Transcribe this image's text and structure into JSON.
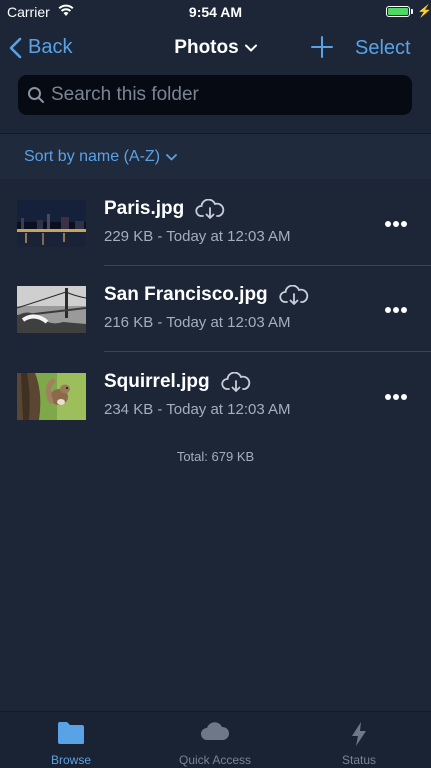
{
  "status_bar": {
    "carrier": "Carrier",
    "time": "9:54 AM",
    "battery_level": 1.0
  },
  "nav": {
    "back_label": "Back",
    "title": "Photos",
    "select_label": "Select"
  },
  "search": {
    "placeholder": "Search this folder",
    "value": ""
  },
  "sort": {
    "label": "Sort by name (A-Z)"
  },
  "files": [
    {
      "name": "Paris.jpg",
      "meta": "229 KB - Today at 12:03 AM",
      "thumbnail": "night-city-skyline"
    },
    {
      "name": "San Francisco.jpg",
      "meta": "216 KB - Today at 12:03 AM",
      "thumbnail": "golden-gate-bridge-bw"
    },
    {
      "name": "Squirrel.jpg",
      "meta": "234 KB - Today at 12:03 AM",
      "thumbnail": "squirrel-on-tree"
    }
  ],
  "total": "Total: 679 KB",
  "tabs": [
    {
      "label": "Browse",
      "icon": "folder-icon",
      "active": true
    },
    {
      "label": "Quick Access",
      "icon": "cloud-icon",
      "active": false
    },
    {
      "label": "Status",
      "icon": "lightning-icon",
      "active": false
    }
  ],
  "colors": {
    "accent": "#5aa2e6",
    "background": "#1c2637",
    "inactive_tab": "#7b8494"
  }
}
